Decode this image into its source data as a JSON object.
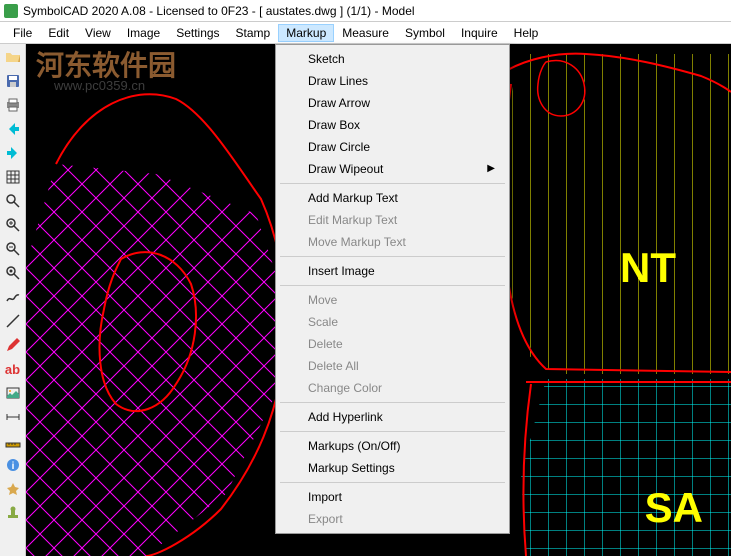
{
  "title": "SymbolCAD 2020 A.08 - Licensed to 0F23  -  [ austates.dwg ] (1/1)  -  Model",
  "menu": {
    "file": "File",
    "edit": "Edit",
    "view": "View",
    "image": "Image",
    "settings": "Settings",
    "stamp": "Stamp",
    "markup": "Markup",
    "measure": "Measure",
    "symbol": "Symbol",
    "inquire": "Inquire",
    "help": "Help"
  },
  "dropdown": {
    "sketch": "Sketch",
    "draw_lines": "Draw Lines",
    "draw_arrow": "Draw Arrow",
    "draw_box": "Draw Box",
    "draw_circle": "Draw Circle",
    "draw_wipeout": "Draw Wipeout",
    "add_markup_text": "Add Markup Text",
    "edit_markup_text": "Edit Markup Text",
    "move_markup_text": "Move Markup Text",
    "insert_image": "Insert Image",
    "move": "Move",
    "scale": "Scale",
    "delete": "Delete",
    "delete_all": "Delete All",
    "change_color": "Change Color",
    "add_hyperlink": "Add Hyperlink",
    "markups_onoff": "Markups (On/Off)",
    "markup_settings": "Markup Settings",
    "import": "Import",
    "export": "Export"
  },
  "watermark": {
    "main": "河东软件园",
    "url": "www.pc0359.cn"
  },
  "labels": {
    "nt": "NT",
    "sa": "SA"
  },
  "toolbar_text": {
    "ab": "ab"
  },
  "colors": {
    "canvas_bg": "#000000",
    "outline_red": "#ff0000",
    "hatch_yellow": "#ffff00",
    "hatch_magenta": "#ff00ff",
    "hatch_cyan": "#00ffff",
    "labels": "#ffff00"
  }
}
